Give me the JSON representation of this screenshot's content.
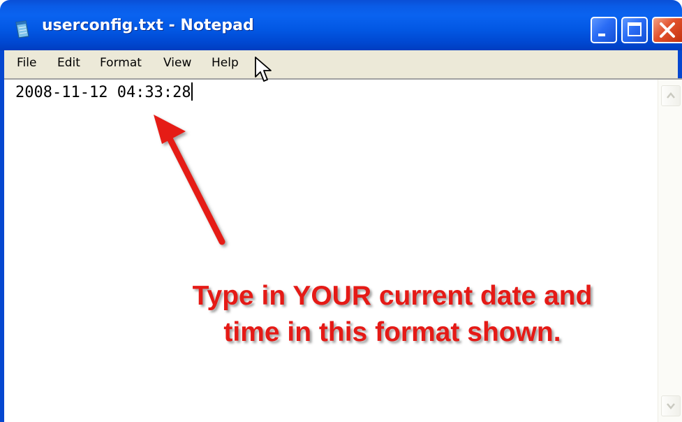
{
  "window": {
    "title": "userconfig.txt - Notepad",
    "app_icon": "notepad-icon",
    "controls": {
      "minimize_icon": "minimize-icon",
      "maximize_icon": "maximize-icon",
      "close_icon": "close-icon"
    },
    "titlebar_color": "#0a5be6",
    "close_color": "#e1512c"
  },
  "menubar": {
    "items": [
      {
        "label": "File"
      },
      {
        "label": "Edit"
      },
      {
        "label": "Format"
      },
      {
        "label": "View"
      },
      {
        "label": "Help"
      }
    ]
  },
  "editor": {
    "content": "2008-11-12 04:33:28"
  },
  "scrollbar": {
    "up_icon": "scroll-up-arrow-icon",
    "down_icon": "scroll-down-arrow-icon"
  },
  "annotation": {
    "line1": "Type in YOUR current date and",
    "line2": "time in this format shown.",
    "color": "#e51a16",
    "arrow_icon": "red-arrow-icon"
  },
  "cursor": {
    "icon": "mouse-pointer-icon"
  }
}
